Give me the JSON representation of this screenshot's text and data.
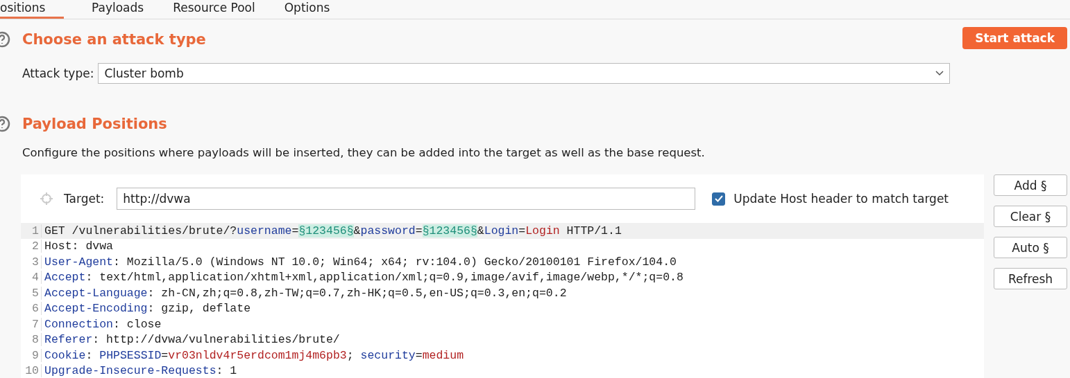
{
  "tabs": [
    {
      "label": "ositions",
      "selected": true
    },
    {
      "label": "Payloads",
      "selected": false
    },
    {
      "label": "Resource Pool",
      "selected": false
    },
    {
      "label": "Options",
      "selected": false
    }
  ],
  "attack_section": {
    "title": "Choose an attack type",
    "start_button": "Start attack",
    "attack_type_label": "Attack type:",
    "attack_type_value": "Cluster bomb"
  },
  "positions_section": {
    "title": "Payload Positions",
    "description": "Configure the positions where payloads will be inserted, they can be added into the target as well as the base request.",
    "target_label": "Target:",
    "target_value": "http://dvwa",
    "update_host": {
      "label": "Update Host header to match target",
      "checked": true
    },
    "buttons": [
      "Add §",
      "Clear §",
      "Auto §",
      "Refresh"
    ],
    "request_lines": [
      {
        "number": "1",
        "highlighted": true,
        "tokens": [
          {
            "kind": "plain",
            "text": "GET /vulnerabilities/brute/?"
          },
          {
            "kind": "key",
            "text": "username"
          },
          {
            "kind": "plain",
            "text": "="
          },
          {
            "kind": "marker",
            "text": "§123456§"
          },
          {
            "kind": "plain",
            "text": "&"
          },
          {
            "kind": "key",
            "text": "password"
          },
          {
            "kind": "plain",
            "text": "="
          },
          {
            "kind": "marker",
            "text": "§123456§"
          },
          {
            "kind": "plain",
            "text": "&"
          },
          {
            "kind": "key",
            "text": "Login"
          },
          {
            "kind": "plain",
            "text": "="
          },
          {
            "kind": "value",
            "text": "Login"
          },
          {
            "kind": "plain",
            "text": " HTTP/1.1"
          }
        ]
      },
      {
        "number": "2",
        "highlighted": false,
        "tokens": [
          {
            "kind": "plain",
            "text": "Host: dvwa"
          }
        ]
      },
      {
        "number": "3",
        "highlighted": false,
        "tokens": [
          {
            "kind": "key",
            "text": "User-Agent"
          },
          {
            "kind": "plain",
            "text": ": Mozilla/5.0 (Windows NT 10.0; Win64; x64; rv:104.0) Gecko/20100101 Firefox/104.0"
          }
        ]
      },
      {
        "number": "4",
        "highlighted": false,
        "tokens": [
          {
            "kind": "key",
            "text": "Accept"
          },
          {
            "kind": "plain",
            "text": ": text/html,application/xhtml+xml,application/xml;q=0.9,image/avif,image/webp,*/*;q=0.8"
          }
        ]
      },
      {
        "number": "5",
        "highlighted": false,
        "tokens": [
          {
            "kind": "key",
            "text": "Accept-Language"
          },
          {
            "kind": "plain",
            "text": ": zh-CN,zh;q=0.8,zh-TW;q=0.7,zh-HK;q=0.5,en-US;q=0.3,en;q=0.2"
          }
        ]
      },
      {
        "number": "6",
        "highlighted": false,
        "tokens": [
          {
            "kind": "key",
            "text": "Accept-Encoding"
          },
          {
            "kind": "plain",
            "text": ": gzip, deflate"
          }
        ]
      },
      {
        "number": "7",
        "highlighted": false,
        "tokens": [
          {
            "kind": "key",
            "text": "Connection"
          },
          {
            "kind": "plain",
            "text": ": close"
          }
        ]
      },
      {
        "number": "8",
        "highlighted": false,
        "tokens": [
          {
            "kind": "key",
            "text": "Referer"
          },
          {
            "kind": "plain",
            "text": ": http://dvwa/vulnerabilities/brute/"
          }
        ]
      },
      {
        "number": "9",
        "highlighted": false,
        "tokens": [
          {
            "kind": "key",
            "text": "Cookie"
          },
          {
            "kind": "plain",
            "text": ": "
          },
          {
            "kind": "key",
            "text": "PHPSESSID"
          },
          {
            "kind": "plain",
            "text": "="
          },
          {
            "kind": "value",
            "text": "vr03nldv4r5erdcom1mj4m6pb3"
          },
          {
            "kind": "plain",
            "text": "; "
          },
          {
            "kind": "key",
            "text": "security"
          },
          {
            "kind": "plain",
            "text": "="
          },
          {
            "kind": "value",
            "text": "medium"
          }
        ]
      },
      {
        "number": "10",
        "highlighted": false,
        "tokens": [
          {
            "kind": "key",
            "text": "Upgrade-Insecure-Requests"
          },
          {
            "kind": "plain",
            "text": ": 1"
          }
        ]
      }
    ]
  }
}
